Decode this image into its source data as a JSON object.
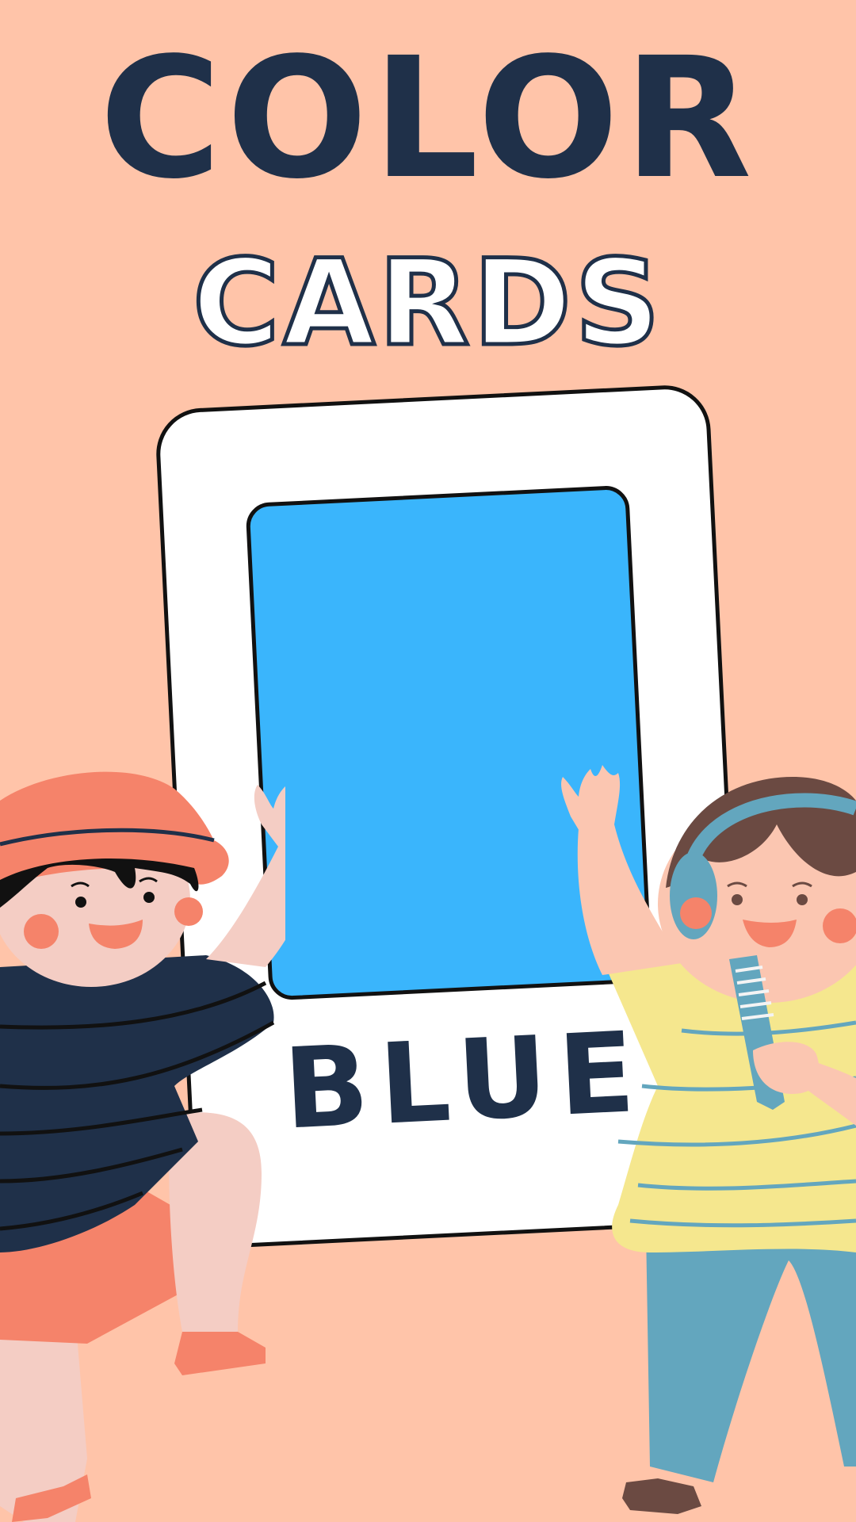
{
  "title": "COLOR",
  "subtitle": "CARDS",
  "card": {
    "label": "BLUE",
    "swatch_color": "#3AB5FC"
  },
  "colors": {
    "background": "#FFC4A9",
    "title_text": "#1F3049",
    "card_fill": "#FFFFFF",
    "outline": "#111111"
  },
  "illustrations": {
    "left_kid_hat_color": "#F5836A",
    "left_kid_shirt_color": "#1F3049",
    "right_kid_shirt_color": "#F5E78E",
    "right_kid_pants_color": "#63A6BE",
    "right_kid_hair_color": "#6B4A42",
    "skin_color": "#F4CDC4"
  }
}
